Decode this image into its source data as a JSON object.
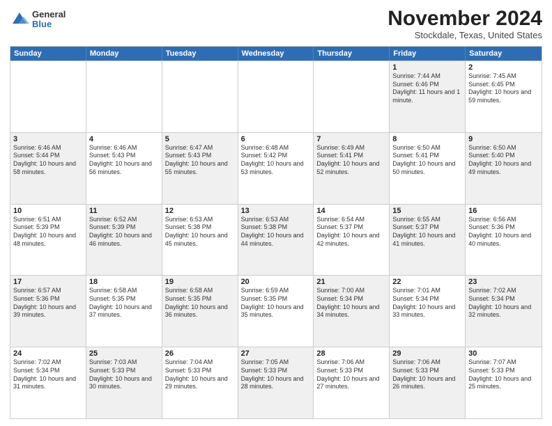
{
  "logo": {
    "general": "General",
    "blue": "Blue"
  },
  "title": "November 2024",
  "location": "Stockdale, Texas, United States",
  "days": [
    "Sunday",
    "Monday",
    "Tuesday",
    "Wednesday",
    "Thursday",
    "Friday",
    "Saturday"
  ],
  "rows": [
    [
      {
        "day": "",
        "text": "",
        "shaded": false
      },
      {
        "day": "",
        "text": "",
        "shaded": false
      },
      {
        "day": "",
        "text": "",
        "shaded": false
      },
      {
        "day": "",
        "text": "",
        "shaded": false
      },
      {
        "day": "",
        "text": "",
        "shaded": false
      },
      {
        "day": "1",
        "text": "Sunrise: 7:44 AM\nSunset: 6:46 PM\nDaylight: 11 hours and 1 minute.",
        "shaded": true
      },
      {
        "day": "2",
        "text": "Sunrise: 7:45 AM\nSunset: 6:45 PM\nDaylight: 10 hours and 59 minutes.",
        "shaded": false
      }
    ],
    [
      {
        "day": "3",
        "text": "Sunrise: 6:46 AM\nSunset: 5:44 PM\nDaylight: 10 hours and 58 minutes.",
        "shaded": true
      },
      {
        "day": "4",
        "text": "Sunrise: 6:46 AM\nSunset: 5:43 PM\nDaylight: 10 hours and 56 minutes.",
        "shaded": false
      },
      {
        "day": "5",
        "text": "Sunrise: 6:47 AM\nSunset: 5:43 PM\nDaylight: 10 hours and 55 minutes.",
        "shaded": true
      },
      {
        "day": "6",
        "text": "Sunrise: 6:48 AM\nSunset: 5:42 PM\nDaylight: 10 hours and 53 minutes.",
        "shaded": false
      },
      {
        "day": "7",
        "text": "Sunrise: 6:49 AM\nSunset: 5:41 PM\nDaylight: 10 hours and 52 minutes.",
        "shaded": true
      },
      {
        "day": "8",
        "text": "Sunrise: 6:50 AM\nSunset: 5:41 PM\nDaylight: 10 hours and 50 minutes.",
        "shaded": false
      },
      {
        "day": "9",
        "text": "Sunrise: 6:50 AM\nSunset: 5:40 PM\nDaylight: 10 hours and 49 minutes.",
        "shaded": true
      }
    ],
    [
      {
        "day": "10",
        "text": "Sunrise: 6:51 AM\nSunset: 5:39 PM\nDaylight: 10 hours and 48 minutes.",
        "shaded": false
      },
      {
        "day": "11",
        "text": "Sunrise: 6:52 AM\nSunset: 5:39 PM\nDaylight: 10 hours and 46 minutes.",
        "shaded": true
      },
      {
        "day": "12",
        "text": "Sunrise: 6:53 AM\nSunset: 5:38 PM\nDaylight: 10 hours and 45 minutes.",
        "shaded": false
      },
      {
        "day": "13",
        "text": "Sunrise: 6:53 AM\nSunset: 5:38 PM\nDaylight: 10 hours and 44 minutes.",
        "shaded": true
      },
      {
        "day": "14",
        "text": "Sunrise: 6:54 AM\nSunset: 5:37 PM\nDaylight: 10 hours and 42 minutes.",
        "shaded": false
      },
      {
        "day": "15",
        "text": "Sunrise: 6:55 AM\nSunset: 5:37 PM\nDaylight: 10 hours and 41 minutes.",
        "shaded": true
      },
      {
        "day": "16",
        "text": "Sunrise: 6:56 AM\nSunset: 5:36 PM\nDaylight: 10 hours and 40 minutes.",
        "shaded": false
      }
    ],
    [
      {
        "day": "17",
        "text": "Sunrise: 6:57 AM\nSunset: 5:36 PM\nDaylight: 10 hours and 39 minutes.",
        "shaded": true
      },
      {
        "day": "18",
        "text": "Sunrise: 6:58 AM\nSunset: 5:35 PM\nDaylight: 10 hours and 37 minutes.",
        "shaded": false
      },
      {
        "day": "19",
        "text": "Sunrise: 6:58 AM\nSunset: 5:35 PM\nDaylight: 10 hours and 36 minutes.",
        "shaded": true
      },
      {
        "day": "20",
        "text": "Sunrise: 6:59 AM\nSunset: 5:35 PM\nDaylight: 10 hours and 35 minutes.",
        "shaded": false
      },
      {
        "day": "21",
        "text": "Sunrise: 7:00 AM\nSunset: 5:34 PM\nDaylight: 10 hours and 34 minutes.",
        "shaded": true
      },
      {
        "day": "22",
        "text": "Sunrise: 7:01 AM\nSunset: 5:34 PM\nDaylight: 10 hours and 33 minutes.",
        "shaded": false
      },
      {
        "day": "23",
        "text": "Sunrise: 7:02 AM\nSunset: 5:34 PM\nDaylight: 10 hours and 32 minutes.",
        "shaded": true
      }
    ],
    [
      {
        "day": "24",
        "text": "Sunrise: 7:02 AM\nSunset: 5:34 PM\nDaylight: 10 hours and 31 minutes.",
        "shaded": false
      },
      {
        "day": "25",
        "text": "Sunrise: 7:03 AM\nSunset: 5:33 PM\nDaylight: 10 hours and 30 minutes.",
        "shaded": true
      },
      {
        "day": "26",
        "text": "Sunrise: 7:04 AM\nSunset: 5:33 PM\nDaylight: 10 hours and 29 minutes.",
        "shaded": false
      },
      {
        "day": "27",
        "text": "Sunrise: 7:05 AM\nSunset: 5:33 PM\nDaylight: 10 hours and 28 minutes.",
        "shaded": true
      },
      {
        "day": "28",
        "text": "Sunrise: 7:06 AM\nSunset: 5:33 PM\nDaylight: 10 hours and 27 minutes.",
        "shaded": false
      },
      {
        "day": "29",
        "text": "Sunrise: 7:06 AM\nSunset: 5:33 PM\nDaylight: 10 hours and 26 minutes.",
        "shaded": true
      },
      {
        "day": "30",
        "text": "Sunrise: 7:07 AM\nSunset: 5:33 PM\nDaylight: 10 hours and 25 minutes.",
        "shaded": false
      }
    ]
  ]
}
